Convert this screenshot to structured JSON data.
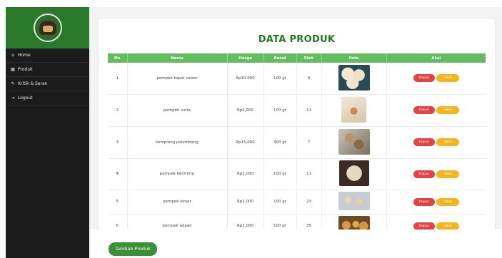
{
  "sidebar": {
    "items": [
      {
        "label": "Home",
        "icon": "home-icon",
        "glyph": "⌂"
      },
      {
        "label": "Produk",
        "icon": "grid-icon",
        "glyph": "▦"
      },
      {
        "label": "Kritik & Saran",
        "icon": "comment-icon",
        "glyph": "✎"
      },
      {
        "label": "Logout",
        "icon": "logout-icon",
        "glyph": "⇥"
      }
    ]
  },
  "main": {
    "title": "DATA PRODUK",
    "add_button": "Tambah Produk"
  },
  "table": {
    "headers": [
      "No",
      "Nama",
      "Harga",
      "Berat",
      "Stok",
      "Foto",
      "Aksi"
    ],
    "rows": [
      {
        "no": "1",
        "nama": "pempek kapal selam",
        "harga": "Rp10.000",
        "berat": "100 gr",
        "stok": "9"
      },
      {
        "no": "2",
        "nama": "pempek sutra",
        "harga": "Rp2,000",
        "berat": "100 gr",
        "stok": "11"
      },
      {
        "no": "3",
        "nama": "kemplang palembang",
        "harga": "Rp15,000",
        "berat": "300 gr",
        "stok": "7"
      },
      {
        "no": "4",
        "nama": "pempek kerinting",
        "harga": "Rp2,000",
        "berat": "100 gr",
        "stok": "11"
      },
      {
        "no": "5",
        "nama": "pempek lenjer",
        "harga": "Rp2,000",
        "berat": "100 gr",
        "stok": "23"
      },
      {
        "no": "6",
        "nama": "pempek adaan",
        "harga": "Rp2,000",
        "berat": "100 gr",
        "stok": "35"
      }
    ],
    "actions": {
      "delete": "Hapus",
      "edit": "Ubah"
    }
  },
  "colors": {
    "brand_green": "#2b7a2b",
    "header_green": "#63bd5e",
    "delete_red": "#e54343",
    "edit_yellow": "#f3b51d"
  }
}
